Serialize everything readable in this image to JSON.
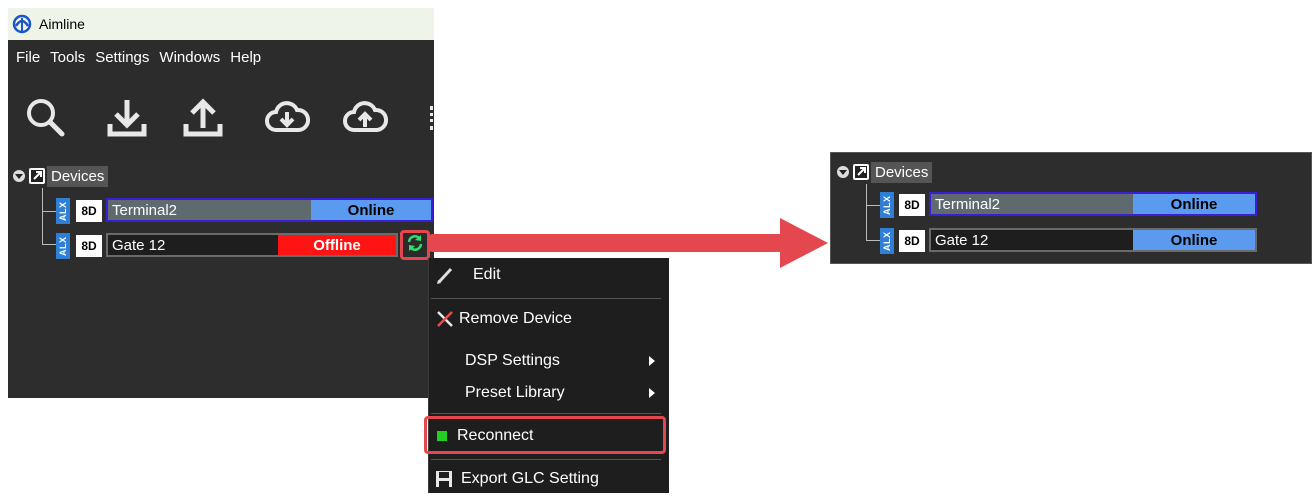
{
  "app": {
    "title": "Aimline",
    "menu": [
      "File",
      "Tools",
      "Settings",
      "Windows",
      "Help"
    ],
    "toolbar_icons": [
      "search-icon",
      "download-icon",
      "upload-icon",
      "cloud-download-icon",
      "cloud-upload-icon"
    ]
  },
  "tree_before": {
    "header": "Devices",
    "devices": [
      {
        "badge_side": "ALX",
        "badge": "8D",
        "name": "Terminal2",
        "status": "Online"
      },
      {
        "badge_side": "ALX",
        "badge": "8D",
        "name": "Gate 12",
        "status": "Offline"
      }
    ]
  },
  "context_menu": {
    "items": [
      {
        "label": "Edit",
        "icon": "pencil-icon"
      },
      {
        "label": "Remove Device",
        "icon": "x-icon"
      },
      {
        "label": "DSP Settings",
        "submenu": true
      },
      {
        "label": "Preset Library",
        "submenu": true
      },
      {
        "label": "Reconnect",
        "icon": "green-square-icon"
      },
      {
        "label": "Export GLC Setting",
        "icon": "floppy-icon"
      }
    ]
  },
  "tree_after": {
    "header": "Devices",
    "devices": [
      {
        "badge_side": "ALX",
        "badge": "8D",
        "name": "Terminal2",
        "status": "Online"
      },
      {
        "badge_side": "ALX",
        "badge": "8D",
        "name": "Gate 12",
        "status": "Online"
      }
    ]
  },
  "colors": {
    "online": "#5b9bef",
    "offline": "#ff1313",
    "highlight": "#e4474e",
    "selection_border": "#3a1fd6"
  }
}
